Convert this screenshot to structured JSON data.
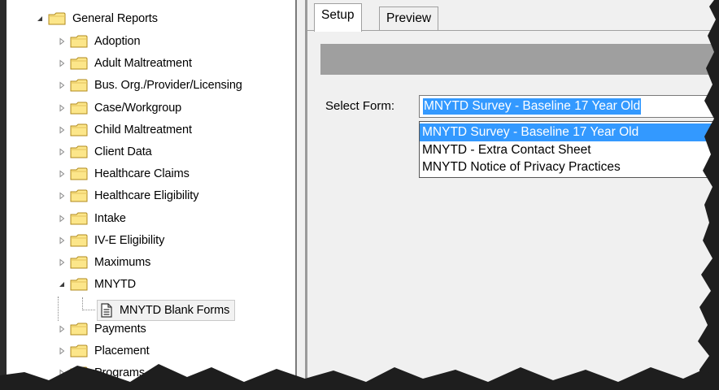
{
  "tree": {
    "root": {
      "label": "General Reports",
      "expanded": true
    },
    "items": [
      {
        "label": "Adoption",
        "expanded": false
      },
      {
        "label": "Adult Maltreatment",
        "expanded": false
      },
      {
        "label": "Bus. Org./Provider/Licensing",
        "expanded": false
      },
      {
        "label": "Case/Workgroup",
        "expanded": false
      },
      {
        "label": "Child Maltreatment",
        "expanded": false
      },
      {
        "label": "Client Data",
        "expanded": false
      },
      {
        "label": "Healthcare Claims",
        "expanded": false
      },
      {
        "label": "Healthcare Eligibility",
        "expanded": false
      },
      {
        "label": "Intake",
        "expanded": false
      },
      {
        "label": "IV-E Eligibility",
        "expanded": false
      },
      {
        "label": "Maximums",
        "expanded": false
      },
      {
        "label": "MNYTD",
        "expanded": true
      },
      {
        "label": "Payments",
        "expanded": false
      },
      {
        "label": "Placement",
        "expanded": false
      },
      {
        "label": "Programs",
        "expanded": false
      }
    ],
    "selected_child": {
      "label": "MNYTD Blank Forms"
    }
  },
  "tabs": [
    {
      "label": "Setup",
      "active": true
    },
    {
      "label": "Preview",
      "active": false
    }
  ],
  "form": {
    "select_label": "Select Form:",
    "selected_value": "MNYTD Survey - Baseline 17 Year Old",
    "options": [
      {
        "label": "MNYTD Survey - Baseline 17 Year Old",
        "highlighted": true
      },
      {
        "label": "MNYTD - Extra Contact Sheet",
        "highlighted": false
      },
      {
        "label": "MNYTD Notice of Privacy Practices",
        "highlighted": false
      }
    ]
  },
  "colors": {
    "selection": "#3399ff",
    "folder_fill": "#fce68a",
    "folder_stroke": "#b08a1c",
    "header_bar": "#9f9f9f"
  },
  "icons": {
    "folder": "folder-icon",
    "document": "document-icon",
    "expanded": "triangle-expanded-icon",
    "collapsed": "triangle-collapsed-icon"
  }
}
